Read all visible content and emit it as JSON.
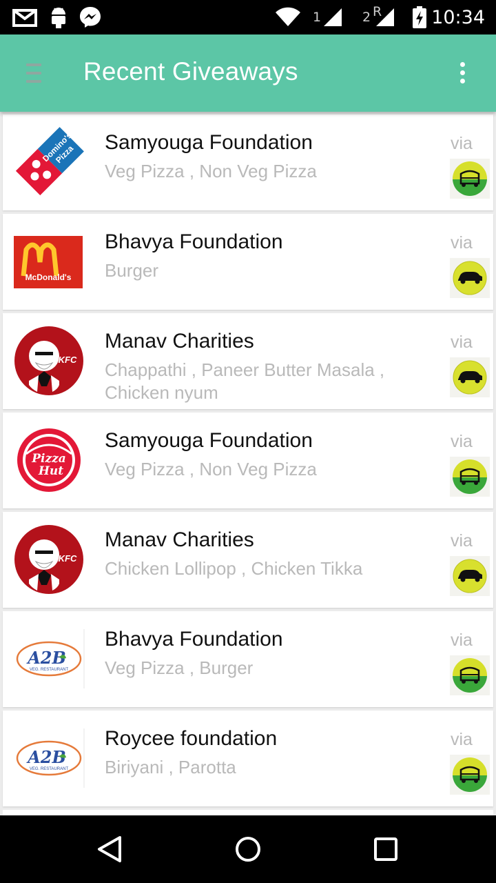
{
  "status_bar": {
    "time": "10:34",
    "sim1": "1",
    "sim2": "2",
    "roaming": "R"
  },
  "app_bar": {
    "title": "Recent Giveaways"
  },
  "colors": {
    "accent": "#5cc6a6",
    "subtitle": "#b9b9b9",
    "auto_green": "#3aa73a",
    "auto_yellow": "#d6df2a",
    "car_yellow": "#d8e02e"
  },
  "giveaways": [
    {
      "name": "Samyouga Foundation",
      "items": "Veg Pizza , Non Veg Pizza",
      "via": "via",
      "logo": "dominos-pizza-logo",
      "vehicle": "auto-rickshaw-icon"
    },
    {
      "name": "Bhavya Foundation",
      "items": "Burger",
      "via": "via",
      "logo": "mcdonalds-logo",
      "vehicle": "car-icon"
    },
    {
      "name": "Manav Charities",
      "items": "Chappathi , Paneer Butter Masala , Chicken nyum",
      "via": "via",
      "logo": "kfc-logo",
      "vehicle": "car-icon"
    },
    {
      "name": "Samyouga Foundation",
      "items": "Veg Pizza , Non Veg Pizza",
      "via": "via",
      "logo": "pizza-hut-logo",
      "vehicle": "auto-rickshaw-icon"
    },
    {
      "name": "Manav Charities",
      "items": "Chicken Lollipop , Chicken Tikka",
      "via": "via",
      "logo": "kfc-logo",
      "vehicle": "car-icon"
    },
    {
      "name": "Bhavya Foundation",
      "items": "Veg Pizza , Burger",
      "via": "via",
      "logo": "a2b-logo",
      "vehicle": "auto-rickshaw-icon"
    },
    {
      "name": "Roycee foundation",
      "items": "Biriyani , Parotta",
      "via": "via",
      "logo": "a2b-logo",
      "vehicle": "auto-rickshaw-icon"
    }
  ]
}
